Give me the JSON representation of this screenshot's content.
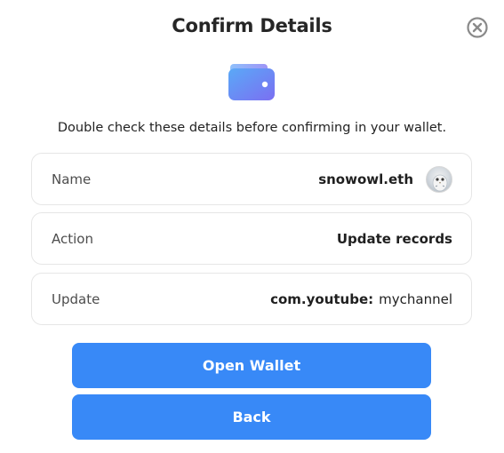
{
  "dialog": {
    "title": "Confirm Details",
    "subtitle": "Double check these details before confirming in your wallet."
  },
  "details": {
    "name": {
      "label": "Name",
      "value": "snowowl.eth",
      "avatar_icon": "owl-avatar"
    },
    "action": {
      "label": "Action",
      "value": "Update records"
    },
    "update": {
      "label": "Update",
      "key": "com.youtube:",
      "value": "mychannel"
    }
  },
  "buttons": {
    "open_wallet": "Open Wallet",
    "back": "Back"
  },
  "icons": {
    "close": "close-circle-icon",
    "wallet": "wallet-icon"
  },
  "colors": {
    "primary": "#3889f7",
    "wallet_gradient_start": "#5aa9f7",
    "wallet_gradient_end": "#7b6ff2"
  }
}
